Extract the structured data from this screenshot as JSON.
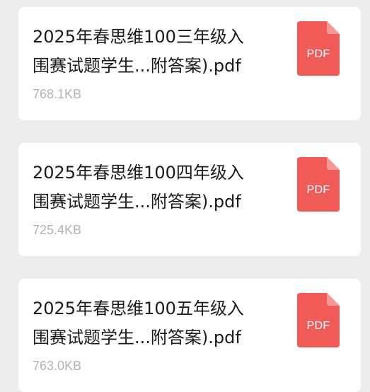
{
  "files": [
    {
      "name_line1": "2025年春思维100三年级入",
      "name_line2": "围赛试题学生...附答案).pdf",
      "size": "768.1KB",
      "type_label": "PDF"
    },
    {
      "name_line1": "2025年春思维100四年级入",
      "name_line2": "围赛试题学生...附答案).pdf",
      "size": "725.4KB",
      "type_label": "PDF"
    },
    {
      "name_line1": "2025年春思维100五年级入",
      "name_line2": "围赛试题学生...附答案).pdf",
      "size": "763.0KB",
      "type_label": "PDF"
    }
  ],
  "colors": {
    "background": "#ededed",
    "card": "#ffffff",
    "pdf_icon": "#f05a57",
    "pdf_fold": "#f59896",
    "size_text": "#b3b3b3"
  },
  "icons": {
    "file_type": "pdf-file-icon"
  }
}
